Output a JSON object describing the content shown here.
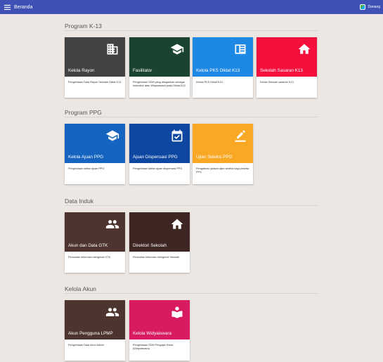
{
  "header": {
    "title": "Beranda",
    "user": "Danang",
    "menu_icon": "hamburger-icon",
    "avatar_colors": [
      "#4caf50",
      "#03a9f4"
    ]
  },
  "sections": [
    {
      "title": "Program K-13",
      "cards": [
        {
          "name": "Kelola Rayon",
          "desc": "Pengelolaan Data Rayon Sekolah Diklat K13",
          "color": "#424242",
          "icon": "building-icon"
        },
        {
          "name": "Fasilitator",
          "desc": "Pengelolaan SDM yang ditugaskan sebagai Instruktur atau Widyaiswara pada Diklat K13",
          "color": "#1b4332",
          "icon": "graduation-cap-icon"
        },
        {
          "name": "Kelola PKS Diklat K13",
          "desc": "Kelola PKS Diklat K13",
          "color": "#1e88e5",
          "icon": "document-icon"
        },
        {
          "name": "Sekolah Sasaran K13",
          "desc": "Kelola Sekolah sasaran K13",
          "color": "#f50f3c",
          "icon": "home-icon"
        }
      ]
    },
    {
      "title": "Program PPG",
      "cards": [
        {
          "name": "Kelola Ajuan PPG",
          "desc": "Pengelolaan daftar ajuan PPG",
          "color": "#1565c0",
          "icon": "graduation-cap-icon"
        },
        {
          "name": "Ajuan Dispensasi PPG",
          "desc": "Pengelolaan daftar ajuan dispensasi PPG",
          "color": "#0d47a1",
          "icon": "calendar-check-icon"
        },
        {
          "name": "Ujian Seleksi PPG",
          "desc": "Pengaturan jadwal ujian seleksi bagi peserta PPG",
          "color": "#f9a825",
          "icon": "pencil-icon"
        }
      ]
    },
    {
      "title": "Data Induk",
      "cards": [
        {
          "name": "Akun dan Data GTK",
          "desc": "Pencarian informasi mengenai GTK",
          "color": "#4e342e",
          "icon": "people-icon"
        },
        {
          "name": "Direktori Sekolah",
          "desc": "Pencarian informasi mengenai Sekolah",
          "color": "#3e2723",
          "icon": "home-icon"
        }
      ]
    },
    {
      "title": "Kelola Akun",
      "cards": [
        {
          "name": "Akun Pengguna LPMP",
          "desc": "Pengelolaan Data Akun Admin",
          "color": "#4e342e",
          "icon": "people-icon"
        },
        {
          "name": "Kelola Widyaiswara",
          "desc": "Pengelolaan SDM Pengajar Kelas (Widyaiswara)",
          "color": "#d81b60",
          "icon": "reader-icon"
        }
      ]
    }
  ]
}
